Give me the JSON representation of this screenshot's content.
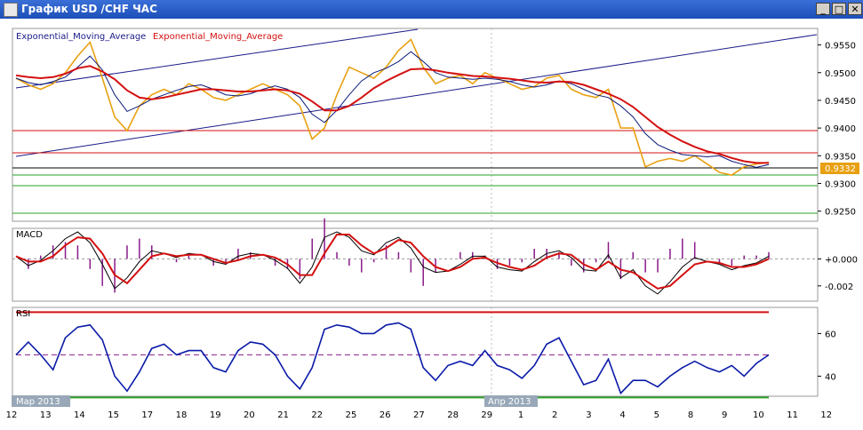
{
  "window": {
    "title": "График USD /CHF  ЧАС",
    "minimize_glyph": "_",
    "maximize_glyph": "□",
    "close_glyph": "✕"
  },
  "chart_data": [
    {
      "type": "line",
      "panel": "price",
      "legend": [
        "Exponential_Moving_Average",
        "Exponential_Moving_Average"
      ],
      "ylim": [
        0.9235,
        0.9575
      ],
      "yticks": [
        "0.9550",
        "0.9500",
        "0.9450",
        "0.9400",
        "0.9350",
        "0.9300",
        "0.9250"
      ],
      "current_price_label": "0.9332",
      "series": [
        {
          "name": "Exponential_Moving_Average",
          "color": "#0a1a7a",
          "values": [
            0.949,
            0.9482,
            0.9478,
            0.9484,
            0.9492,
            0.951,
            0.953,
            0.9505,
            0.946,
            0.943,
            0.944,
            0.9452,
            0.946,
            0.9468,
            0.9475,
            0.9478,
            0.947,
            0.946,
            0.9458,
            0.9462,
            0.947,
            0.9476,
            0.947,
            0.9455,
            0.9425,
            0.941,
            0.9432,
            0.946,
            0.9485,
            0.95,
            0.9508,
            0.952,
            0.9538,
            0.952,
            0.95,
            0.9492,
            0.949,
            0.9488,
            0.949,
            0.9488,
            0.9484,
            0.9478,
            0.9474,
            0.9478,
            0.9485,
            0.948,
            0.947,
            0.946,
            0.9455,
            0.944,
            0.942,
            0.939,
            0.937,
            0.936,
            0.9352,
            0.935,
            0.9348,
            0.935,
            0.934,
            0.9334,
            0.9329,
            0.9334
          ]
        },
        {
          "name": "Exponential_Moving_Average",
          "color": "#d41010",
          "values": [
            0.9495,
            0.9492,
            0.949,
            0.9492,
            0.9498,
            0.9508,
            0.9512,
            0.9502,
            0.9488,
            0.9468,
            0.9455,
            0.9452,
            0.9455,
            0.946,
            0.9465,
            0.947,
            0.947,
            0.9468,
            0.9466,
            0.9466,
            0.9468,
            0.947,
            0.9468,
            0.9462,
            0.9448,
            0.9432,
            0.9432,
            0.944,
            0.9455,
            0.9472,
            0.9485,
            0.9496,
            0.9506,
            0.9507,
            0.9504,
            0.95,
            0.9497,
            0.9494,
            0.9493,
            0.9491,
            0.9489,
            0.9486,
            0.9483,
            0.9482,
            0.9484,
            0.9483,
            0.9478,
            0.947,
            0.9462,
            0.9452,
            0.9438,
            0.942,
            0.9402,
            0.9388,
            0.9376,
            0.9366,
            0.9358,
            0.9353,
            0.9346,
            0.934,
            0.9337,
            0.9337
          ]
        },
        {
          "name": "",
          "color": "#e8a010",
          "values": [
            0.949,
            0.9478,
            0.947,
            0.948,
            0.95,
            0.953,
            0.9555,
            0.949,
            0.942,
            0.9395,
            0.944,
            0.946,
            0.947,
            0.946,
            0.948,
            0.947,
            0.9455,
            0.945,
            0.946,
            0.947,
            0.948,
            0.947,
            0.946,
            0.944,
            0.938,
            0.94,
            0.946,
            0.951,
            0.95,
            0.949,
            0.951,
            0.954,
            0.956,
            0.951,
            0.948,
            0.949,
            0.9495,
            0.948,
            0.95,
            0.949,
            0.948,
            0.947,
            0.9475,
            0.949,
            0.9495,
            0.947,
            0.946,
            0.9455,
            0.947,
            0.94,
            0.94,
            0.933,
            0.934,
            0.9345,
            0.934,
            0.935,
            0.9335,
            0.932,
            0.9315,
            0.933,
            0.9335,
            0.9338
          ]
        }
      ]
    },
    {
      "type": "line",
      "panel": "macd",
      "legend": [
        "MACD"
      ],
      "ylim": [
        -0.003,
        0.002
      ],
      "yticks": [
        "+0.000",
        "-0.002"
      ],
      "series": [
        {
          "name": "",
          "color": "#000000",
          "values": [
            0.0002,
            -0.0005,
            -0.0001,
            0.0006,
            0.0015,
            0.002,
            0.0012,
            -0.0004,
            -0.0022,
            -0.0014,
            -0.0002,
            0.0006,
            0.0004,
            0.0001,
            0.0004,
            0.0003,
            -0.0002,
            -0.0004,
            0.0002,
            0.0004,
            0.0003,
            -0.0001,
            -0.0007,
            -0.0018,
            -0.0006,
            0.0016,
            0.002,
            0.0016,
            0.0006,
            0.0003,
            0.0012,
            0.0016,
            0.0008,
            -0.0006,
            -0.001,
            -0.0009,
            -0.0004,
            0.0002,
            0.0002,
            -0.0006,
            -0.0008,
            -0.0009,
            -0.0002,
            0.0004,
            0.0006,
            0.0001,
            -0.0008,
            -0.0009,
            0.0003,
            -0.0014,
            -0.0008,
            -0.002,
            -0.0026,
            -0.0017,
            -0.0006,
            0.0001,
            -0.0002,
            -0.0004,
            -0.0008,
            -0.0005,
            -0.0003,
            0.0002
          ]
        },
        {
          "name": "",
          "color": "#d41010",
          "values": [
            0.0002,
            -0.0002,
            -0.0002,
            0.0002,
            0.001,
            0.0016,
            0.0015,
            0.0004,
            -0.0012,
            -0.0018,
            -0.0008,
            0.0002,
            0.0004,
            0.0002,
            0.0003,
            0.0003,
            0.0,
            -0.0003,
            -0.0001,
            0.0002,
            0.0003,
            0.0001,
            -0.0004,
            -0.0012,
            -0.0012,
            0.0004,
            0.0018,
            0.0018,
            0.001,
            0.0004,
            0.0008,
            0.0014,
            0.0012,
            0.0002,
            -0.0006,
            -0.0009,
            -0.0006,
            0.0,
            0.0001,
            -0.0003,
            -0.0006,
            -0.0008,
            -0.0005,
            0.0001,
            0.0004,
            0.0003,
            -0.0004,
            -0.0008,
            -0.0002,
            -0.0008,
            -0.001,
            -0.0016,
            -0.0022,
            -0.002,
            -0.0012,
            -0.0004,
            -0.0002,
            -0.0003,
            -0.0006,
            -0.0006,
            -0.0004,
            0.0
          ]
        }
      ]
    },
    {
      "type": "line",
      "panel": "rsi",
      "legend": [
        "RSI"
      ],
      "ylim": [
        31,
        71
      ],
      "yticks": [
        "60",
        "40"
      ],
      "levels": [
        70,
        50,
        30
      ],
      "series": [
        {
          "name": "",
          "color": "#0a1aa8",
          "values": [
            50,
            56,
            50,
            43,
            58,
            63,
            64,
            57,
            40,
            33,
            42,
            53,
            55,
            50,
            52,
            52,
            44,
            42,
            52,
            56,
            55,
            50,
            40,
            34,
            44,
            62,
            64,
            63,
            60,
            60,
            64,
            65,
            62,
            44,
            38,
            45,
            47,
            45,
            52,
            45,
            43,
            39,
            45,
            55,
            58,
            47,
            36,
            38,
            48,
            32,
            38,
            38,
            35,
            40,
            44,
            47,
            44,
            42,
            45,
            40,
            46,
            50
          ]
        }
      ]
    }
  ],
  "x_axis": {
    "labels": [
      "12",
      "13",
      "14",
      "15",
      "17",
      "18",
      "19",
      "20",
      "21",
      "22",
      "25",
      "26",
      "27",
      "28",
      "29",
      "1",
      "2",
      "3",
      "4",
      "5",
      "8",
      "9",
      "10",
      "11",
      "12"
    ],
    "month_labels": [
      "Мар 2013",
      "Апр 2013"
    ]
  }
}
